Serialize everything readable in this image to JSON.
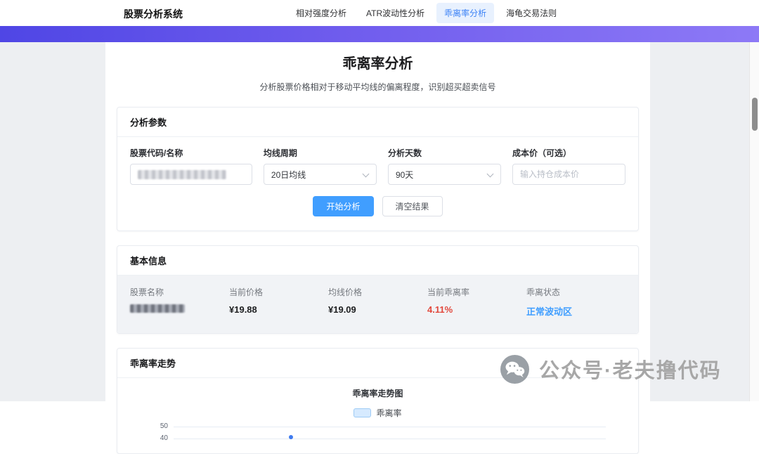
{
  "navbar": {
    "brand": "股票分析系统",
    "items": [
      {
        "label": "相对强度分析",
        "active": false
      },
      {
        "label": "ATR波动性分析",
        "active": false
      },
      {
        "label": "乖离率分析",
        "active": true
      },
      {
        "label": "海龟交易法则",
        "active": false
      }
    ]
  },
  "page": {
    "title": "乖离率分析",
    "subtitle": "分析股票价格相对于移动平均线的偏离程度，识别超买超卖信号"
  },
  "params": {
    "title": "分析参数",
    "stock_label": "股票代码/名称",
    "stock_value_redacted": true,
    "ma_label": "均线周期",
    "ma_value": "20日均线",
    "days_label": "分析天数",
    "days_value": "90天",
    "cost_label": "成本价（可选）",
    "cost_placeholder": "输入持仓成本价",
    "start_button": "开始分析",
    "clear_button": "清空结果"
  },
  "info": {
    "title": "基本信息",
    "items": [
      {
        "label": "股票名称",
        "value": "",
        "redacted": true
      },
      {
        "label": "当前价格",
        "value": "¥19.88"
      },
      {
        "label": "均线价格",
        "value": "¥19.09"
      },
      {
        "label": "当前乖离率",
        "value": "4.11%",
        "color": "#e2483d"
      },
      {
        "label": "乖离状态",
        "value": "正常波动区",
        "color": "#409EFF"
      }
    ]
  },
  "chart": {
    "section_title": "乖离率走势",
    "title": "乖离率走势图",
    "legend": "乖离率",
    "y_ticks": [
      "50",
      "40"
    ],
    "legend_swatch_color": "#d6eaff",
    "series_color": "#3f7bef"
  },
  "watermark": {
    "text": "公众号·老夫撸代码"
  },
  "colors": {
    "primary": "#409EFF",
    "nav_active_bg": "#e8f1fe",
    "nav_active_text": "#3b82f6",
    "banner_gradient_start": "#4f46e5",
    "banner_gradient_end": "#8d79f6",
    "negative_red": "#e2483d",
    "status_blue": "#409EFF",
    "page_background": "#edeff2"
  }
}
